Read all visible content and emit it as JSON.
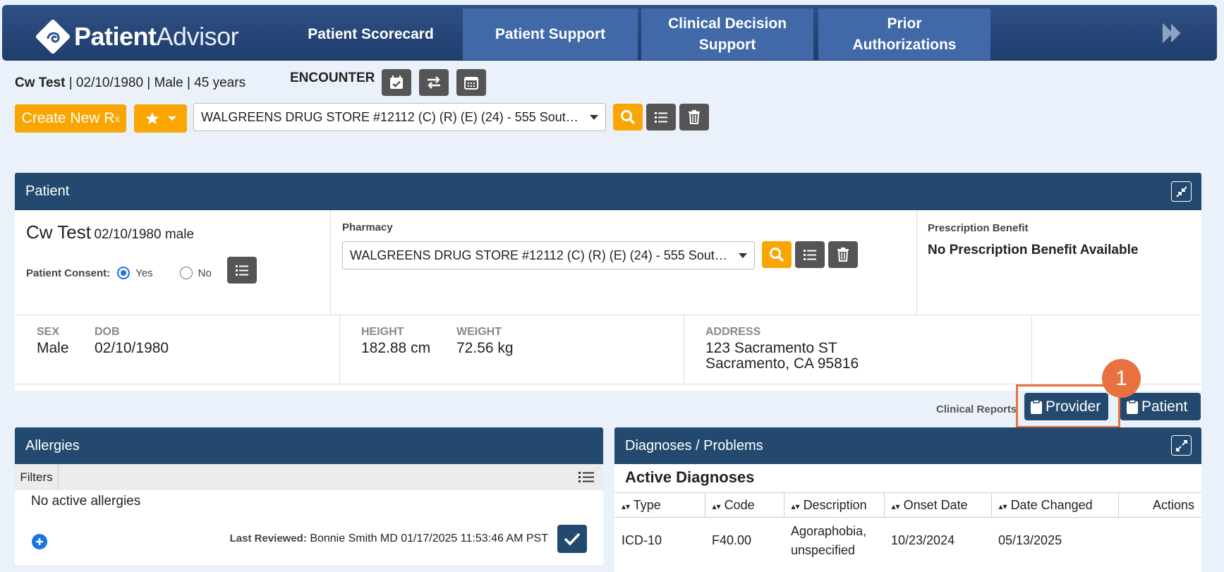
{
  "brand": {
    "name_bold": "Patient",
    "name_light": "Advisor"
  },
  "nav": {
    "tabs": [
      {
        "label": "Patient Scorecard"
      },
      {
        "label": "Patient Support"
      },
      {
        "label_line1": "Clinical Decision",
        "label_line2": "Support"
      },
      {
        "label_line1": "Prior",
        "label_line2": "Authorizations"
      }
    ]
  },
  "encounter": {
    "patient_name": "Cw Test",
    "patient_info": " | 02/10/1980 | Male | 45 years",
    "label": "ENCOUNTER",
    "create_label": "Create New R",
    "create_sub": "x",
    "pharmacy_select": "WALGREENS DRUG STORE #12112 (C) (R) (E) (24) - 555 South…"
  },
  "patient_panel": {
    "title": "Patient",
    "name": "Cw Test",
    "dob_sex": "02/10/1980 male",
    "consent_label": "Patient Consent:",
    "consent_yes": "Yes",
    "consent_no": "No",
    "pharmacy_label": "Pharmacy",
    "pharmacy_value": "WALGREENS DRUG STORE #12112 (C) (R) (E) (24) - 555 South…",
    "benefit_label": "Prescription Benefit",
    "benefit_value": "No Prescription Benefit Available",
    "sex_cap": "SEX",
    "sex": "Male",
    "dob_cap": "DOB",
    "dob": "02/10/1980",
    "height_cap": "HEIGHT",
    "height": "182.88 cm",
    "weight_cap": "WEIGHT",
    "weight": "72.56 kg",
    "address_cap": "ADDRESS",
    "address1": "123 Sacramento ST",
    "address2": "Sacramento, CA 95816"
  },
  "clinical_reports": {
    "label": "Clinical Reports",
    "provider": "Provider",
    "patient": "Patient",
    "step_badge": "1"
  },
  "allergies": {
    "title": "Allergies",
    "filters": "Filters",
    "empty": "No active allergies",
    "last_reviewed_label": "Last Reviewed:",
    "last_reviewed_value": "Bonnie Smith MD 01/17/2025 11:53:46 AM PST"
  },
  "diagnoses": {
    "title": "Diagnoses / Problems",
    "subtitle": "Active Diagnoses",
    "columns": [
      "Type",
      "Code",
      "Description",
      "Onset Date",
      "Date Changed",
      "Actions"
    ],
    "rows": [
      {
        "type": "ICD-10",
        "code": "F40.00",
        "desc1": "Agoraphobia,",
        "desc2": "unspecified",
        "onset": "10/23/2024",
        "changed": "05/13/2025"
      }
    ]
  },
  "colors": {
    "accent_orange": "#f9a602",
    "navy": "#234a6e",
    "highlight": "#e8713f"
  }
}
